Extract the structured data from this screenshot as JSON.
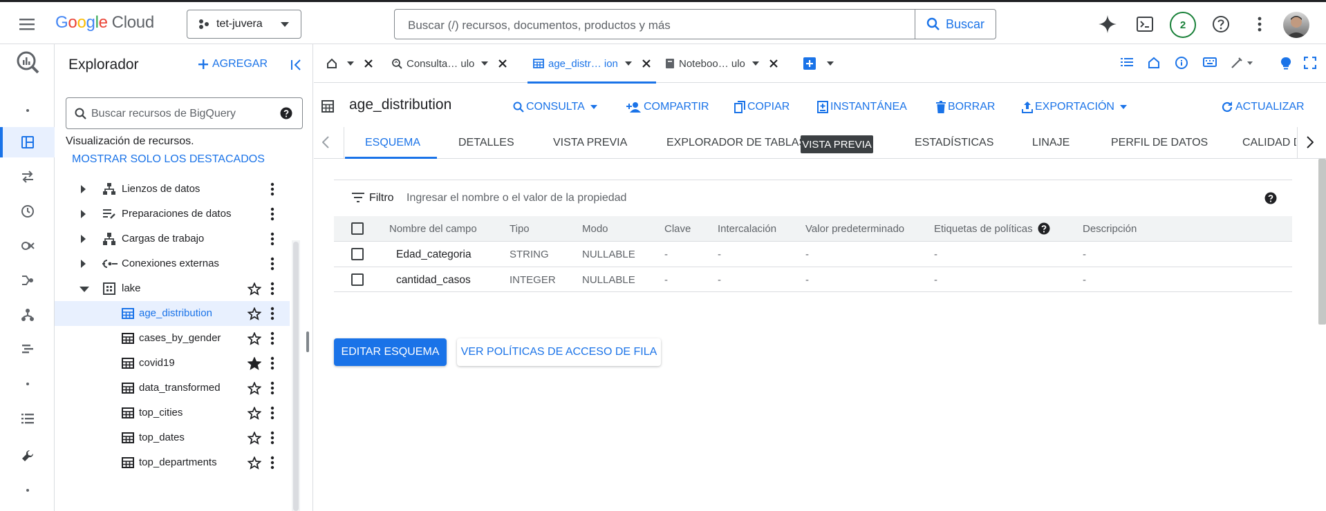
{
  "topbar": {
    "logo_letters": [
      "G",
      "o",
      "o",
      "g",
      "l",
      "e"
    ],
    "logo_product": "Cloud",
    "project": "tet-juvera",
    "search_placeholder": "Buscar (/) recursos, documentos, productos y más",
    "search_button": "Buscar",
    "notifications_count": "2"
  },
  "explorer": {
    "title": "Explorador",
    "add_label": "AGREGAR",
    "search_placeholder": "Buscar recursos de BigQuery",
    "visualization_label": "Visualización de recursos.",
    "show_starred": "MOSTRAR SOLO LOS DESTACADOS",
    "tree": [
      {
        "label": "Lienzos de datos"
      },
      {
        "label": "Preparaciones de datos"
      },
      {
        "label": "Cargas de trabajo"
      },
      {
        "label": "Conexiones externas"
      },
      {
        "label": "lake"
      },
      {
        "label": "age_distribution",
        "starred": false,
        "selected": true
      },
      {
        "label": "cases_by_gender",
        "starred": false
      },
      {
        "label": "covid19",
        "starred": true
      },
      {
        "label": "data_transformed",
        "starred": false
      },
      {
        "label": "top_cities",
        "starred": false
      },
      {
        "label": "top_dates",
        "starred": false
      },
      {
        "label": "top_departments",
        "starred": false
      }
    ]
  },
  "tabs": [
    {
      "label": "Consulta… ulo"
    },
    {
      "label": "age_distr… ion",
      "active": true
    },
    {
      "label": "Noteboo… ulo"
    }
  ],
  "content": {
    "title": "age_distribution",
    "actions": [
      "CONSULTA",
      "COMPARTIR",
      "COPIAR",
      "INSTANTÁNEA",
      "BORRAR",
      "EXPORTACIÓN",
      "ACTUALIZAR"
    ],
    "subtabs": [
      "ESQUEMA",
      "DETALLES",
      "VISTA PREVIA",
      "EXPLORADOR DE TABLAS",
      "ESTADÍSTICAS",
      "LINAJE",
      "PERFIL DE DATOS",
      "CALIDAD D"
    ],
    "subtab_badge": "VISTA PREVIA",
    "filter_label": "Filtro",
    "filter_placeholder": "Ingresar el nombre o el valor de la propiedad",
    "columns": [
      "Nombre del campo",
      "Tipo",
      "Modo",
      "Clave",
      "Intercalación",
      "Valor predeterminado",
      "Etiquetas de políticas",
      "Descripción"
    ],
    "rows": [
      [
        "Edad_categoria",
        "STRING",
        "NULLABLE",
        "-",
        "-",
        "-",
        "-",
        "-"
      ],
      [
        "cantidad_casos",
        "INTEGER",
        "NULLABLE",
        "-",
        "-",
        "-",
        "-",
        "-"
      ]
    ],
    "edit_schema": "EDITAR ESQUEMA",
    "row_policies": "VER POLÍTICAS DE ACCESO DE FILA"
  },
  "colors": {
    "accent": "#1a73e8",
    "selected_bg": "#e8f0fe",
    "text": "#202124",
    "muted": "#5f6368"
  }
}
